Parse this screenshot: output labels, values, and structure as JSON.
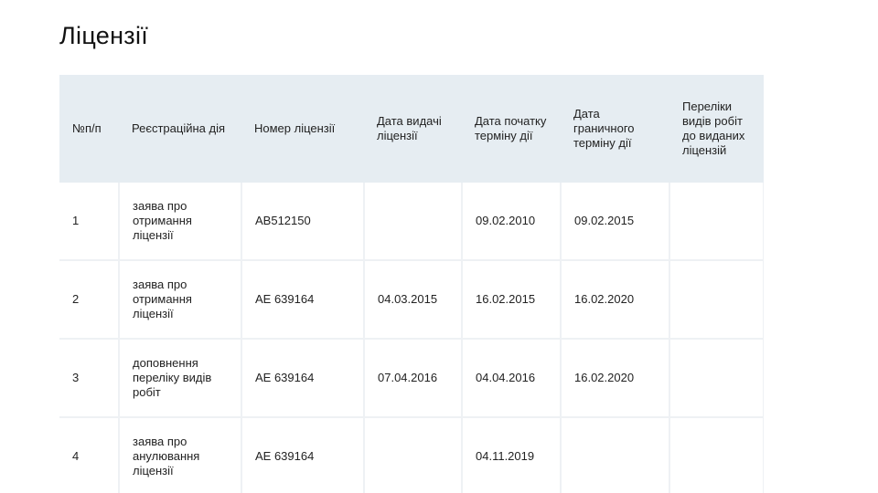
{
  "page": {
    "title": "Ліцензії"
  },
  "table": {
    "headers": [
      "№п/п",
      "Реєстраційна дія",
      "Номер ліцензії",
      "Дата видачі ліцензії",
      "Дата початку терміну дії",
      "Дата граничного терміну дії",
      "Переліки видів робіт до виданих ліцензій"
    ],
    "rows": [
      [
        "1",
        "заява про отримання ліцензії",
        "AB512150",
        "",
        "09.02.2010",
        "09.02.2015",
        ""
      ],
      [
        "2",
        "заява про отримання ліцензії",
        "AE 639164",
        "04.03.2015",
        "16.02.2015",
        "16.02.2020",
        ""
      ],
      [
        "3",
        "доповнення переліку видів робіт",
        "AE 639164",
        "07.04.2016",
        "04.04.2016",
        "16.02.2020",
        ""
      ],
      [
        "4",
        "заява про анулювання ліцензії",
        "AE 639164",
        "",
        "04.11.2019",
        "",
        ""
      ]
    ]
  }
}
